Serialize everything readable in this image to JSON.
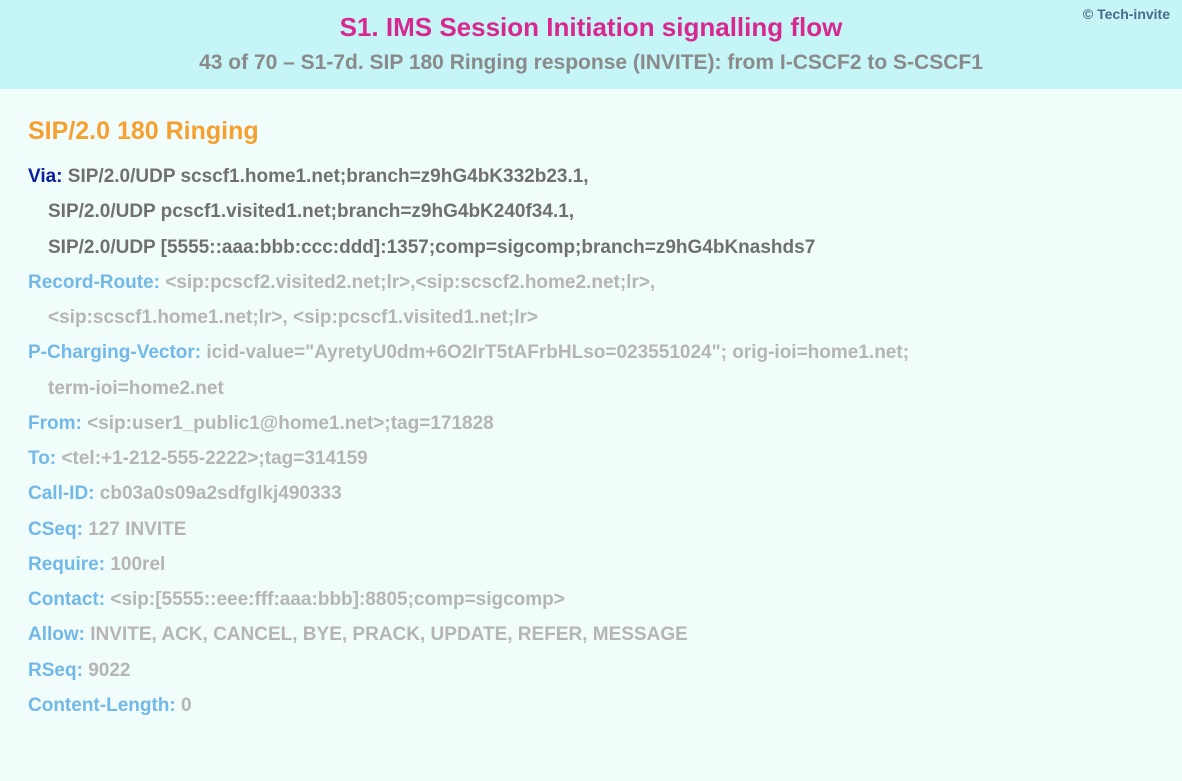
{
  "header": {
    "title": "S1. IMS Session Initiation signalling flow",
    "subtitle": "43 of 70 – S1-7d. SIP 180 Ringing response (INVITE): from I-CSCF2 to S-CSCF1",
    "copyright": "© Tech-invite"
  },
  "sip": {
    "status_line": "SIP/2.0 180 Ringing",
    "via": {
      "label": "Via:",
      "line1": "SIP/2.0/UDP scscf1.home1.net;branch=z9hG4bK332b23.1,",
      "line2": "SIP/2.0/UDP pcscf1.visited1.net;branch=z9hG4bK240f34.1,",
      "line3": "SIP/2.0/UDP [5555::aaa:bbb:ccc:ddd]:1357;comp=sigcomp;branch=z9hG4bKnashds7"
    },
    "record_route": {
      "label": "Record-Route:",
      "line1": "<sip:pcscf2.visited2.net;lr>,<sip:scscf2.home2.net;lr>,",
      "line2": "<sip:scscf1.home1.net;lr>, <sip:pcscf1.visited1.net;lr>"
    },
    "p_charging_vector": {
      "label": "P-Charging-Vector:",
      "line1": "icid-value=\"AyretyU0dm+6O2IrT5tAFrbHLso=023551024\"; orig-ioi=home1.net;",
      "line2": "term-ioi=home2.net"
    },
    "from": {
      "label": "From:",
      "value": "<sip:user1_public1@home1.net>;tag=171828"
    },
    "to": {
      "label": "To:",
      "value": "<tel:+1-212-555-2222>;tag=314159"
    },
    "call_id": {
      "label": "Call-ID:",
      "value": "cb03a0s09a2sdfglkj490333"
    },
    "cseq": {
      "label": "CSeq:",
      "value": "127 INVITE"
    },
    "require": {
      "label": "Require:",
      "value": "100rel"
    },
    "contact": {
      "label": "Contact:",
      "value": "<sip:[5555::eee:fff:aaa:bbb]:8805;comp=sigcomp>"
    },
    "allow": {
      "label": "Allow:",
      "value": "INVITE, ACK, CANCEL, BYE, PRACK, UPDATE, REFER, MESSAGE"
    },
    "rseq": {
      "label": "RSeq:",
      "value": "9022"
    },
    "content_length": {
      "label": "Content-Length:",
      "value": "0"
    }
  }
}
